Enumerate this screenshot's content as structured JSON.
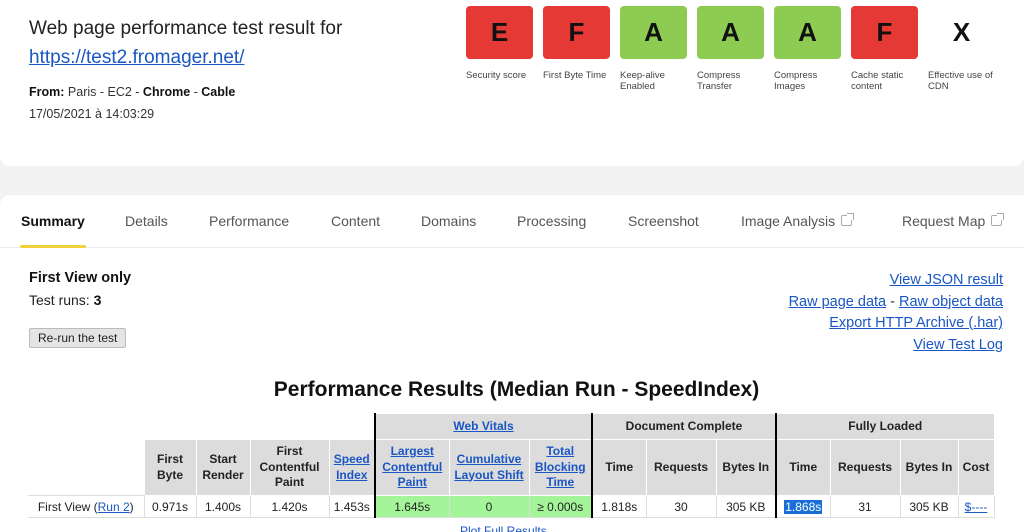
{
  "header": {
    "title": "Web page performance test result for",
    "url": "https://test2.fromager.net/",
    "from_label": "From:",
    "location": "Paris - EC2",
    "browser": "Chrome",
    "connection": "Cable",
    "separator": " - ",
    "date": "17/05/2021 à 14:03:29"
  },
  "grades": [
    {
      "letter": "E",
      "label": "Security score",
      "color": "#e53935"
    },
    {
      "letter": "F",
      "label": "First Byte Time",
      "color": "#e53935"
    },
    {
      "letter": "A",
      "label": "Keep-alive Enabled",
      "color": "#8dcb52"
    },
    {
      "letter": "A",
      "label": "Compress Transfer",
      "color": "#8dcb52"
    },
    {
      "letter": "A",
      "label": "Compress Images",
      "color": "#8dcb52"
    },
    {
      "letter": "F",
      "label": "Cache static content",
      "color": "#e53935"
    },
    {
      "letter": "X",
      "label": "Effective use of CDN",
      "color": "#ffffff"
    }
  ],
  "tabs": [
    {
      "label": "Summary",
      "active": true
    },
    {
      "label": "Details"
    },
    {
      "label": "Performance"
    },
    {
      "label": "Content"
    },
    {
      "label": "Domains"
    },
    {
      "label": "Processing"
    },
    {
      "label": "Screenshot"
    },
    {
      "label": "Image Analysis",
      "external": true
    },
    {
      "label": "Request Map",
      "external": true
    }
  ],
  "summary": {
    "view_title": "First View only",
    "runs_label": "Test runs:",
    "runs_value": "3",
    "rerun_button": "Re-run the test"
  },
  "links": {
    "json": "View JSON result",
    "raw_page": "Raw page data",
    "dash": "-",
    "raw_object": "Raw object data",
    "har": "Export HTTP Archive (.har)",
    "log": "View Test Log"
  },
  "results": {
    "title": "Performance Results (Median Run - SpeedIndex)",
    "groups": {
      "web_vitals": "Web Vitals",
      "document_complete": "Document Complete",
      "fully_loaded": "Fully Loaded"
    },
    "columns": {
      "first_byte": "First Byte",
      "start_render": "Start Render",
      "fcp": "First Contentful Paint",
      "speed_index": "Speed Index",
      "lcp": "Largest Contentful Paint",
      "cls": "Cumulative Layout Shift",
      "tbt": "Total Blocking Time",
      "dc_time": "Time",
      "dc_requests": "Requests",
      "dc_bytes": "Bytes In",
      "fl_time": "Time",
      "fl_requests": "Requests",
      "fl_bytes": "Bytes In",
      "cost": "Cost"
    },
    "row": {
      "label": "First View (",
      "run_link": "Run 2",
      "label_end": ")",
      "first_byte": "0.971s",
      "start_render": "1.400s",
      "fcp": "1.420s",
      "speed_index": "1.453s",
      "lcp": "1.645s",
      "cls": "0",
      "tbt": "≥ 0.000s",
      "dc_time": "1.818s",
      "dc_requests": "30",
      "dc_bytes": "305 KB",
      "fl_time": "1.868s",
      "fl_requests": "31",
      "fl_bytes": "305 KB",
      "cost": "$----"
    },
    "plot_link": "Plot Full Results"
  }
}
